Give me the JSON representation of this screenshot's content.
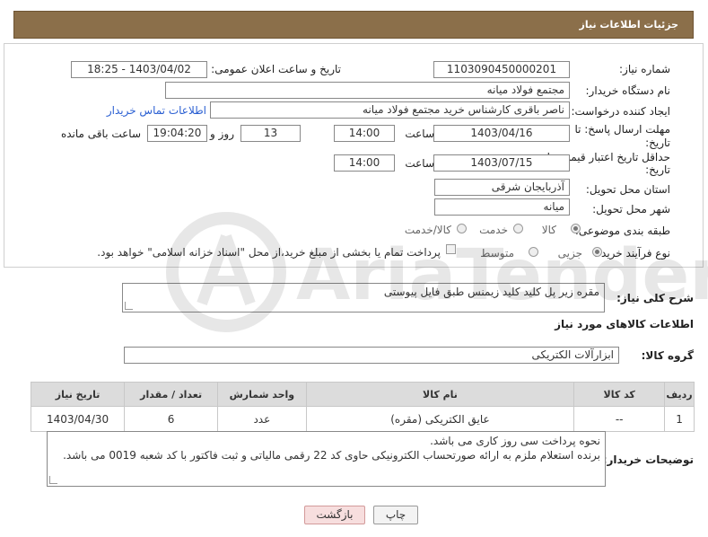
{
  "header": {
    "title": "جزئیات اطلاعات نیاز"
  },
  "form": {
    "need_number": {
      "label": "شماره نیاز:",
      "value": "1103090450000201"
    },
    "announce_datetime": {
      "label": "تاریخ و ساعت اعلان عمومی:",
      "value": "1403/04/02 - 18:25"
    },
    "buyer_org": {
      "label": "نام دستگاه خریدار:",
      "value": "مجتمع فولاد میانه"
    },
    "requester": {
      "label": "ایجاد کننده درخواست:",
      "value": "ناصر باقری کارشناس خرید مجتمع فولاد میانه",
      "contact_link": "اطلاعات تماس خریدار"
    },
    "deadline": {
      "label_line1": "مهلت ارسال پاسخ: تا",
      "label_line2": "تاریخ:",
      "date": "1403/04/16",
      "time_label": "ساعت",
      "time": "14:00",
      "days": "13",
      "days_label": "روز و",
      "remaining": "19:04:20",
      "remaining_label": "ساعت باقی مانده"
    },
    "price_validity": {
      "label_line1": "حداقل تاریخ اعتبار قیمت: تا",
      "label_line2": "تاریخ:",
      "date": "1403/07/15",
      "time_label": "ساعت",
      "time": "14:00"
    },
    "delivery_province": {
      "label": "استان محل تحویل:",
      "value": "آذربایجان شرقی"
    },
    "delivery_city": {
      "label": "شهر محل تحویل:",
      "value": "میانه"
    },
    "category": {
      "label": "طبقه بندی موضوعی:",
      "options": [
        "کالا",
        "خدمت",
        "کالا/خدمت"
      ],
      "selected": "کالا"
    },
    "purchase_type": {
      "label": "نوع فرآیند خرید :",
      "options": [
        "جزیی",
        "متوسط"
      ],
      "selected": "جزیی",
      "checkbox_text": "پرداخت تمام یا بخشی از مبلغ خرید،از محل \"اسناد خزانه اسلامی\" خواهد بود."
    }
  },
  "description": {
    "label": "شرح کلی نیاز:",
    "value": "مقره زیر پل کلید کلید زیمنس طبق فایل پیوستی"
  },
  "goods_section": {
    "title": "اطلاعات کالاهای مورد نیاز"
  },
  "goods_group": {
    "label": "گروه کالا:",
    "value": "ابزارآلات الکتریکی"
  },
  "table": {
    "headers": [
      "ردیف",
      "کد کالا",
      "نام کالا",
      "واحد شمارش",
      "تعداد / مقدار",
      "تاریخ نیاز"
    ],
    "rows": [
      [
        "1",
        "--",
        "عایق الکتریکی (مقره)",
        "عدد",
        "6",
        "1403/04/30"
      ]
    ]
  },
  "buyer_notes": {
    "label": "توضیحات خریدار:",
    "line1": "نحوه پرداخت سی روز کاری می باشد.",
    "line2": "برنده استعلام ملزم به ارائه صورتحساب الکترونیکی حاوی کد 22 رقمی مالیاتی و  ثبت فاکتور با کد شعبه 0019  می باشد."
  },
  "buttons": {
    "print": "چاپ",
    "back": "بازگشت"
  },
  "watermark": {
    "text": "AriaTender.neT"
  }
}
